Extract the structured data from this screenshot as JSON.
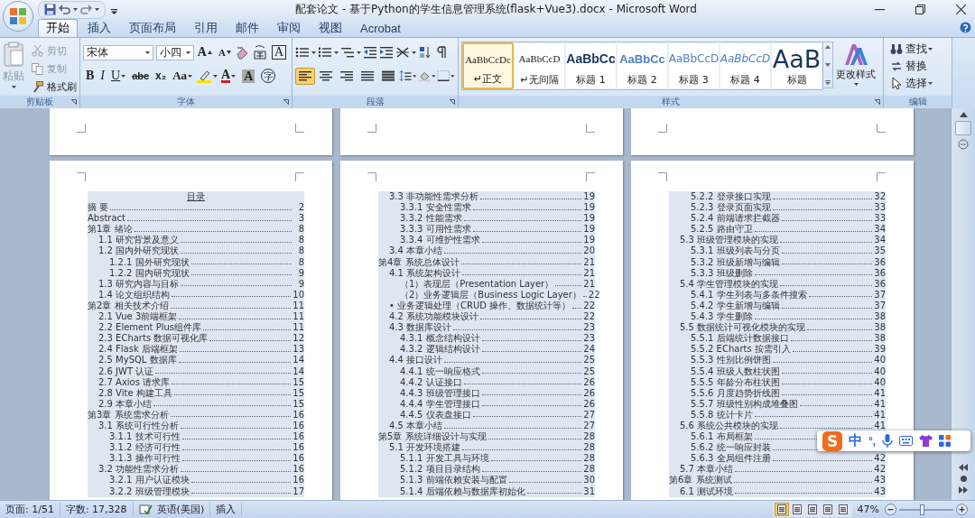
{
  "window": {
    "title": "配套论文 - 基于Python的学生信息管理系统(flask+Vue3).docx - Microsoft Word"
  },
  "ribbon_tabs": [
    {
      "label": "开始",
      "selected": true
    },
    {
      "label": "插入",
      "selected": false
    },
    {
      "label": "页面布局",
      "selected": false
    },
    {
      "label": "引用",
      "selected": false
    },
    {
      "label": "邮件",
      "selected": false
    },
    {
      "label": "审阅",
      "selected": false
    },
    {
      "label": "视图",
      "selected": false
    },
    {
      "label": "Acrobat",
      "selected": false
    }
  ],
  "clipboard": {
    "group": "剪贴板",
    "paste": {
      "label": "粘贴",
      "disabled": true
    },
    "tools": [
      {
        "kind": "cut",
        "label": "剪切",
        "disabled": true
      },
      {
        "kind": "copy",
        "label": "复制",
        "disabled": true
      },
      {
        "kind": "painter",
        "label": "格式刷",
        "disabled": false
      }
    ]
  },
  "font": {
    "group": "字体",
    "name": "宋体",
    "size": "小四",
    "tools_top": [
      {
        "kind": "grow",
        "label": "A"
      },
      {
        "kind": "shrink",
        "label": "A"
      },
      {
        "kind": "clear"
      },
      {
        "kind": "phonetic"
      },
      {
        "kind": "border",
        "label": "A"
      }
    ],
    "tools_bottom": [
      {
        "kind": "bold",
        "label": "B"
      },
      {
        "kind": "italic",
        "label": "I"
      },
      {
        "kind": "underline",
        "label": "U"
      },
      {
        "kind": "strike",
        "label": "abc"
      },
      {
        "kind": "subscript",
        "label": "x₂"
      },
      {
        "kind": "case",
        "label": "Aa"
      },
      {
        "kind": "highlight"
      },
      {
        "kind": "color",
        "label": "A"
      },
      {
        "kind": "shading",
        "label": "A"
      },
      {
        "kind": "enclose",
        "label": "字"
      }
    ]
  },
  "paragraph": {
    "group": "段落",
    "alignments": [
      {
        "selected": true
      },
      {
        "selected": false
      },
      {
        "selected": false
      },
      {
        "selected": false
      },
      {
        "selected": false
      }
    ]
  },
  "styles": {
    "group": "样式",
    "change": "更改样式",
    "items": [
      {
        "kind": "normal",
        "preview": "AaBbCcDc",
        "label": "↵正文",
        "selected": true
      },
      {
        "kind": "normal",
        "preview": "AaBbCcD",
        "label": "↵无间隔",
        "selected": false
      },
      {
        "kind": "heading1",
        "preview": "AaBbCc",
        "label": "标题 1",
        "selected": false
      },
      {
        "kind": "heading2",
        "preview": "AaBbCc",
        "label": "标题 2",
        "selected": false
      },
      {
        "kind": "heading3",
        "preview": "AaBbCcD",
        "label": "标题 3",
        "selected": false
      },
      {
        "kind": "heading4",
        "preview": "AaBbCcD",
        "label": "标题 4",
        "selected": false
      },
      {
        "kind": "title",
        "preview": "AaB",
        "label": "标题",
        "selected": false
      }
    ]
  },
  "editing": {
    "group": "编辑",
    "tools": [
      {
        "kind": "find",
        "label": "查找"
      },
      {
        "kind": "replace",
        "label": "替换"
      },
      {
        "kind": "select",
        "label": "选择"
      }
    ]
  },
  "pages": [
    {
      "title": "目录",
      "entries": [
        {
          "text": "摘 要",
          "page": "2"
        },
        {
          "text": "Abstract",
          "page": "3"
        },
        {
          "text": "第1章 绪论",
          "page": "8",
          "children": [
            {
              "text": "1.1 研究背景及意义",
              "page": "8"
            },
            {
              "text": "1.2 国内外研究现状",
              "page": "8",
              "children": [
                {
                  "text": "1.2.1 国外研究现状",
                  "page": "8"
                },
                {
                  "text": "1.2.2 国内研究现状",
                  "page": "9"
                }
              ]
            },
            {
              "text": "1.3 研究内容与目标",
              "page": "9"
            },
            {
              "text": "1.4 论文组织结构",
              "page": "10"
            }
          ]
        },
        {
          "text": "第2章 相关技术介绍",
          "page": "11",
          "children": [
            {
              "text": "2.1 Vue 3前端框架",
              "page": "11"
            },
            {
              "text": "2.2 Element Plus组件库",
              "page": "11"
            },
            {
              "text": "2.3 ECharts 数据可视化库",
              "page": "12"
            },
            {
              "text": "2.4 Flask 后端框架",
              "page": "13"
            },
            {
              "text": "2.5 MySQL 数据库",
              "page": "14"
            },
            {
              "text": "2.6 JWT 认证",
              "page": "14"
            },
            {
              "text": "2.7 Axios 请求库",
              "page": "15"
            },
            {
              "text": "2.8 Vite 构建工具",
              "page": "15"
            },
            {
              "text": "2.9 本章小结",
              "page": "15"
            }
          ]
        },
        {
          "text": "第3章 系统需求分析",
          "page": "16",
          "children": [
            {
              "text": "3.1 系统可行性分析",
              "page": "16",
              "children": [
                {
                  "text": "3.1.1 技术可行性",
                  "page": "16"
                },
                {
                  "text": "3.1.2 经济可行性",
                  "page": "16"
                },
                {
                  "text": "3.1.3 操作可行性",
                  "page": "16"
                }
              ]
            },
            {
              "text": "3.2 功能性需求分析",
              "page": "16",
              "children": [
                {
                  "text": "3.2.1 用户认证模块",
                  "page": "16"
                },
                {
                  "text": "3.2.2 班级管理模块",
                  "page": "17"
                }
              ]
            }
          ]
        }
      ]
    },
    {
      "entries": [
        {
          "children": [
            {
              "text": "3.3 非功能性需求分析",
              "page": "19",
              "children": [
                {
                  "text": "3.3.1 安全性需求",
                  "page": "19"
                },
                {
                  "text": "3.3.2 性能需求",
                  "page": "19"
                },
                {
                  "text": "3.3.3 可用性需求",
                  "page": "19"
                },
                {
                  "text": "3.3.4 可维护性需求",
                  "page": "19"
                }
              ]
            },
            {
              "text": "3.4 本章小结",
              "page": "20"
            }
          ]
        },
        {
          "text": "第4章 系统总体设计",
          "page": "21",
          "children": [
            {
              "text": "4.1 系统架构设计",
              "page": "21",
              "children": [
                {
                  "text": "（1）表现层（Presentation Layer）",
                  "page": "21"
                },
                {
                  "text": "（2）业务逻辑层（Business Logic Layer）",
                  "page": "22"
                }
              ]
            },
            {
              "text": "• 业务逻辑处理（CRUD 操作、数据统计等）",
              "page": "22"
            },
            {
              "text": "4.2 系统功能模块设计",
              "page": "22"
            },
            {
              "text": "4.3 数据库设计",
              "page": "23",
              "children": [
                {
                  "text": "4.3.1 概念结构设计",
                  "page": "23"
                },
                {
                  "text": "4.3.2 逻辑结构设计",
                  "page": "24"
                }
              ]
            },
            {
              "text": "4.4 接口设计",
              "page": "25",
              "children": [
                {
                  "text": "4.4.1 统一响应格式",
                  "page": "25"
                },
                {
                  "text": "4.4.2 认证接口",
                  "page": "26"
                },
                {
                  "text": "4.4.3 班级管理接口",
                  "page": "26"
                },
                {
                  "text": "4.4.4 学生管理接口",
                  "page": "26"
                },
                {
                  "text": "4.4.5 仪表盘接口",
                  "page": "27"
                }
              ]
            },
            {
              "text": "4.5 本章小结",
              "page": "27"
            }
          ]
        },
        {
          "text": "第5章 系统详细设计与实现",
          "page": "28",
          "children": [
            {
              "text": "5.1 开发环境搭建",
              "page": "28",
              "children": [
                {
                  "text": "5.1.1 开发工具与环境",
                  "page": "28"
                },
                {
                  "text": "5.1.2 项目目录结构",
                  "page": "28"
                },
                {
                  "text": "5.1.3 前端依赖安装与配置",
                  "page": "30"
                },
                {
                  "text": "5.1.4 后端依赖与数据库初始化",
                  "page": "31"
                }
              ]
            }
          ]
        }
      ]
    },
    {
      "entries": [
        {
          "children": [
            {
              "children": [
                {
                  "text": "5.2.2 登录接口实现",
                  "page": "32"
                },
                {
                  "text": "5.2.3 登录页面实现",
                  "page": "33"
                },
                {
                  "text": "5.2.4 前端请求拦截器",
                  "page": "33"
                },
                {
                  "text": "5.2.5 路由守卫",
                  "page": "34"
                }
              ]
            },
            {
              "text": "5.3 班级管理模块的实现",
              "page": "34",
              "children": [
                {
                  "text": "5.3.1 班级列表与分页",
                  "page": "35"
                },
                {
                  "text": "5.3.2 班级新增与编辑",
                  "page": "36"
                },
                {
                  "text": "5.3.3 班级删除",
                  "page": "36"
                }
              ]
            },
            {
              "text": "5.4 学生管理模块的实现",
              "page": "36",
              "children": [
                {
                  "text": "5.4.1 学生列表与多条件搜索",
                  "page": "37"
                },
                {
                  "text": "5.4.2 学生新增与编辑",
                  "page": "37"
                },
                {
                  "text": "5.4.3 学生删除",
                  "page": "38"
                }
              ]
            },
            {
              "text": "5.5 数据统计可视化模块的实现",
              "page": "38",
              "children": [
                {
                  "text": "5.5.1 后端统计数据接口",
                  "page": "38"
                },
                {
                  "text": "5.5.2 ECharts 按需引入",
                  "page": "39"
                },
                {
                  "text": "5.5.3 性别比例饼图",
                  "page": "40"
                },
                {
                  "text": "5.5.4 班级人数柱状图",
                  "page": "40"
                },
                {
                  "text": "5.5.5 年龄分布柱状图",
                  "page": "40"
                },
                {
                  "text": "5.5.6 月度趋势折线图",
                  "page": "41"
                },
                {
                  "text": "5.5.7 班级性别构成堆叠图",
                  "page": "41"
                },
                {
                  "text": "5.5.8 统计卡片",
                  "page": "41"
                }
              ]
            },
            {
              "text": "5.6 系统公共模块的实现",
              "page": "41",
              "children": [
                {
                  "text": "5.6.1 布局框架"
                },
                {
                  "text": "5.6.2 统一响应封装"
                },
                {
                  "text": "5.6.3 全局组件注册",
                  "page": "42"
                }
              ]
            },
            {
              "text": "5.7 本章小结",
              "page": "42"
            }
          ]
        },
        {
          "text": "第6章 系统测试",
          "page": "43",
          "children": [
            {
              "text": "6.1 测试环境",
              "page": "43"
            }
          ]
        }
      ]
    }
  ],
  "status_bar": {
    "page": "页面: 1/51",
    "words": "字数: 17,328",
    "language": "英语(美国)",
    "mode": "插入",
    "views": [
      {
        "selected": true
      },
      {
        "selected": false
      },
      {
        "selected": false
      },
      {
        "selected": false
      },
      {
        "selected": false
      }
    ],
    "zoom": "47%",
    "zoom_slider": {
      "level": 0.42
    }
  },
  "ime": {
    "logo": "S",
    "mode": "中",
    "punctuation": "°,"
  }
}
